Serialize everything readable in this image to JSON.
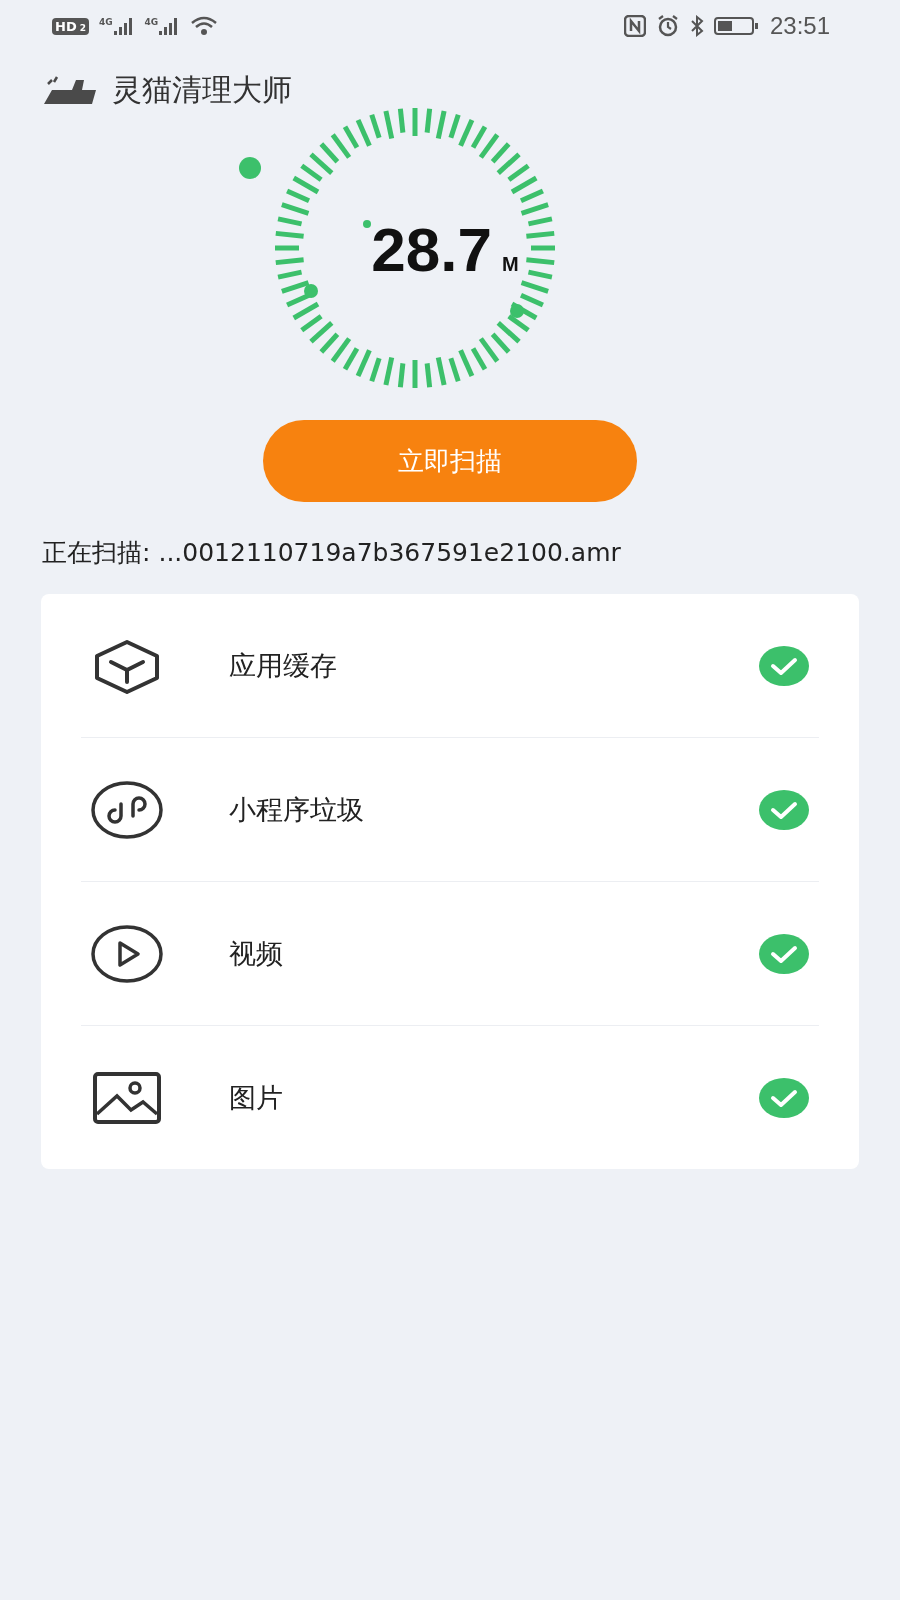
{
  "status_bar": {
    "hd": "HD",
    "hd_sim": "2",
    "networks": [
      {
        "label": "4G"
      },
      {
        "label": "4G"
      }
    ],
    "time": "23:51"
  },
  "header": {
    "title": "灵猫清理大师"
  },
  "gauge": {
    "value": "28.7",
    "unit": "M"
  },
  "scan_button": {
    "label": "立即扫描"
  },
  "scanning": {
    "label": "正在扫描:",
    "path": "...0012110719a7b367591e2100.amr"
  },
  "items": [
    {
      "kind": "cache",
      "label": "应用缓存",
      "checked": true
    },
    {
      "kind": "miniprogram",
      "label": "小程序垃圾",
      "checked": true
    },
    {
      "kind": "video",
      "label": "视频",
      "checked": true
    },
    {
      "kind": "image",
      "label": "图片",
      "checked": true
    }
  ]
}
